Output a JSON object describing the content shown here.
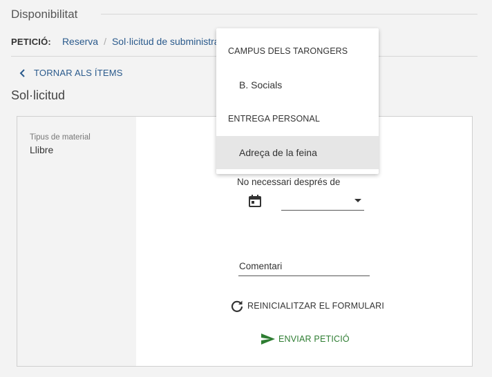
{
  "section": {
    "title": "Disponibilitat"
  },
  "request": {
    "label": "PETICIÓ:",
    "crumb1": "Reserva",
    "separator": "/",
    "crumb2": "Sol·licitud de subministra"
  },
  "back": {
    "label": "TORNAR ALS ÍTEMS",
    "icon": "chevron-left-icon"
  },
  "page": {
    "title": "Sol·licitud"
  },
  "material": {
    "label": "Tipus de material",
    "value": "Llibre"
  },
  "form": {
    "date_label": "No necessari després de",
    "date_value": "",
    "comment_label": "Comentari",
    "reset_label": "REINICIALITZAR EL FORMULARI",
    "send_label": "ENVIAR PETICIÓ"
  },
  "dropdown": {
    "groups": [
      {
        "label": "CAMPUS DELS TARONGERS",
        "items": [
          {
            "label": "B. Socials",
            "selected": false
          }
        ]
      },
      {
        "label": "ENTREGA PERSONAL",
        "items": [
          {
            "label": "Adreça de la feina",
            "selected": true
          }
        ]
      }
    ]
  },
  "colors": {
    "link": "#2a5a8c",
    "send": "#2e7d32",
    "selected_bg": "#e6e6e6"
  }
}
